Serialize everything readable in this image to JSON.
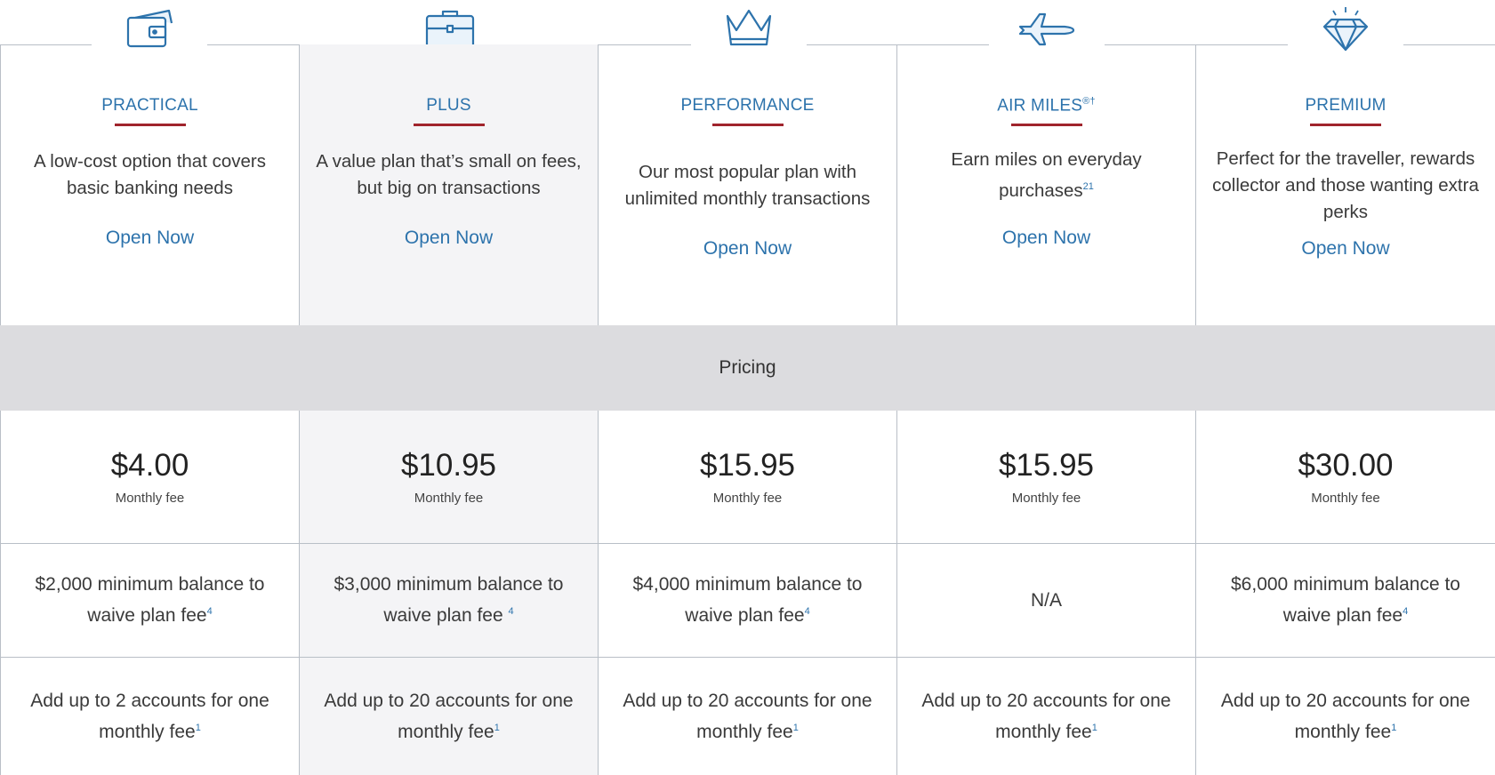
{
  "colors": {
    "link": "#2d73ac",
    "accent_underline": "#a0242c",
    "band": "#dcdcdf",
    "border": "#b9bfc7"
  },
  "pricing_label": "Pricing",
  "plans": [
    {
      "name": "PRACTICAL",
      "name_sup": "",
      "icon": "wallet-icon",
      "description": "A low-cost option that covers basic banking needs",
      "desc_sup": "",
      "cta": "Open Now",
      "price": "$4.00",
      "price_label": "Monthly fee",
      "balance": "$2,000 minimum balance to waive plan fee",
      "balance_sup": "4",
      "accounts": "Add up to 2 accounts for one monthly fee",
      "accounts_sup": "1"
    },
    {
      "name": "PLUS",
      "name_sup": "",
      "icon": "briefcase-icon",
      "description": "A value plan that’s small on fees, but big on transactions",
      "desc_sup": "",
      "cta": "Open Now",
      "price": "$10.95",
      "price_label": "Monthly fee",
      "balance": "$3,000 minimum balance to waive plan fee ",
      "balance_sup": "4",
      "accounts": "Add up to 20 accounts for one monthly fee",
      "accounts_sup": "1"
    },
    {
      "name": "PERFORMANCE",
      "name_sup": "",
      "icon": "crown-icon",
      "description": "Our most popular plan with unlimited monthly transactions",
      "desc_sup": "",
      "cta": "Open Now",
      "price": "$15.95",
      "price_label": "Monthly fee",
      "balance": "$4,000 minimum balance to waive plan fee",
      "balance_sup": "4",
      "accounts": "Add up to 20 accounts for one monthly fee",
      "accounts_sup": "1"
    },
    {
      "name": "AIR MILES",
      "name_sup": "®†",
      "icon": "airplane-icon",
      "description": "Earn miles on everyday purchases",
      "desc_sup": "21",
      "cta": "Open Now",
      "price": "$15.95",
      "price_label": "Monthly fee",
      "balance": "N/A",
      "balance_sup": "",
      "accounts": "Add up to 20 accounts for one monthly fee",
      "accounts_sup": "1"
    },
    {
      "name": "PREMIUM",
      "name_sup": "",
      "icon": "diamond-icon",
      "description": "Perfect for the traveller, rewards collector and those wanting extra perks",
      "desc_sup": "",
      "cta": "Open Now",
      "price": "$30.00",
      "price_label": "Monthly fee",
      "balance": "$6,000 minimum balance to waive plan fee",
      "balance_sup": "4",
      "accounts": "Add up to 20 accounts for one monthly fee",
      "accounts_sup": "1"
    }
  ]
}
